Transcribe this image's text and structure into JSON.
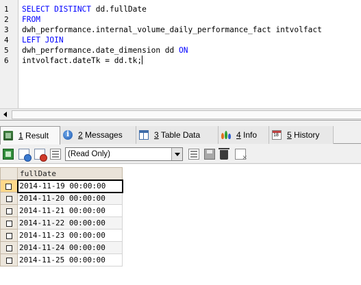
{
  "editor": {
    "line_numbers": [
      "1",
      "2",
      "3",
      "4",
      "5",
      "6"
    ],
    "lines": [
      [
        {
          "t": "SELECT DISTINCT ",
          "k": true
        },
        {
          "t": "dd.fullDate",
          "k": false
        }
      ],
      [
        {
          "t": "FROM",
          "k": true
        }
      ],
      [
        {
          "t": "dwh_performance.internal_volume_daily_performance_fact intvolfact",
          "k": false
        }
      ],
      [
        {
          "t": "LEFT JOIN",
          "k": true
        }
      ],
      [
        {
          "t": "dwh_performance.date_dimension dd ",
          "k": false
        },
        {
          "t": "ON",
          "k": true
        }
      ],
      [
        {
          "t": "intvolfact.dateTk = dd.tk;",
          "k": false
        }
      ]
    ]
  },
  "tabs": [
    {
      "num": "1",
      "label": "Result",
      "icon": "result-grid-icon",
      "active": true
    },
    {
      "num": "2",
      "label": "Messages",
      "icon": "messages-info-icon",
      "active": false
    },
    {
      "num": "3",
      "label": "Table Data",
      "icon": "table-data-icon",
      "active": false
    },
    {
      "num": "4",
      "label": "Info",
      "icon": "info-icon",
      "active": false
    },
    {
      "num": "5",
      "label": "History",
      "icon": "history-calendar-icon",
      "active": false
    }
  ],
  "toolbar": {
    "mode_select_value": "(Read Only)"
  },
  "grid": {
    "columns": [
      "fullDate"
    ],
    "rows": [
      [
        "2014-11-19 00:00:00"
      ],
      [
        "2014-11-20 00:00:00"
      ],
      [
        "2014-11-21 00:00:00"
      ],
      [
        "2014-11-22 00:00:00"
      ],
      [
        "2014-11-23 00:00:00"
      ],
      [
        "2014-11-24 00:00:00"
      ],
      [
        "2014-11-25 00:00:00"
      ]
    ]
  },
  "colors": {
    "keyword": "#0000ff",
    "header_bg": "#e9e2d8",
    "selected_row_marker": "#ffd88a"
  }
}
